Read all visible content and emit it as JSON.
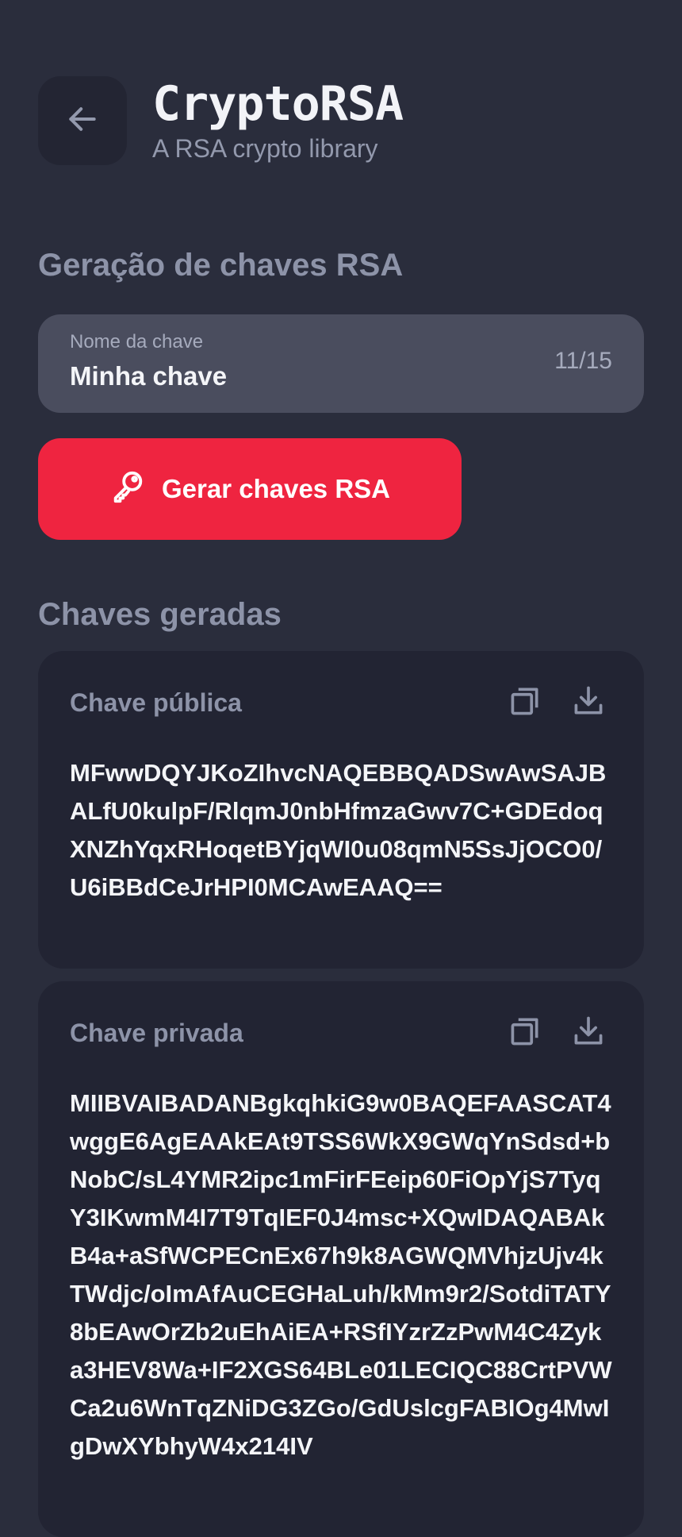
{
  "header": {
    "title": "CryptoRSA",
    "subtitle": "A RSA crypto library",
    "back_icon": "arrow-left-icon"
  },
  "generation": {
    "section_title": "Geração de chaves RSA",
    "key_name_field": {
      "label": "Nome da chave",
      "value": "Minha chave",
      "counter": "11/15"
    },
    "generate_button": {
      "label": "Gerar chaves RSA",
      "icon": "key-icon"
    }
  },
  "generated": {
    "section_title": "Chaves geradas",
    "public_key": {
      "title": "Chave pública",
      "value": "MFwwDQYJKoZIhvcNAQEBBQADSwAwSAJBALfU0kulpF/RlqmJ0nbHfmzaGwv7C+GDEdoqXNZhYqxRHoqetBYjqWI0u08qmN5SsJjOCO0/U6iBBdCeJrHPI0MCAwEAAQ==",
      "copy_icon": "copy-icon",
      "download_icon": "download-icon"
    },
    "private_key": {
      "title": "Chave privada",
      "value": "MIIBVAIBADANBgkqhkiG9w0BAQEFAASCAT4wggE6AgEAAkEAt9TSS6WkX9GWqYnSdsd+bNobC/sL4YMR2ipc1mFirFEeip60FiOpYjS7TyqY3IKwmM4I7T9TqIEF0J4msc+XQwIDAQABAkB4a+aSfWCPECnEx67h9k8AGWQMVhjzUjv4kTWdjc/oImAfAuCEGHaLuh/kMm9r2/SotdiTATY8bEAwOrZb2uEhAiEA+RSfIYzrZzPwM4C4Zyka3HEV8Wa+IF2XGS64BLe01LECIQC88CrtPVWCa2u6WnTqZNiDG3ZGo/GdUslcgFABIOg4MwIgDwXYbhyW4x214IV",
      "copy_icon": "copy-icon",
      "download_icon": "download-icon"
    }
  },
  "colors": {
    "background": "#2a2d3c",
    "card": "#222433",
    "field": "#4a4d5e",
    "accent": "#ef2440",
    "muted_text": "#8d93a8"
  }
}
